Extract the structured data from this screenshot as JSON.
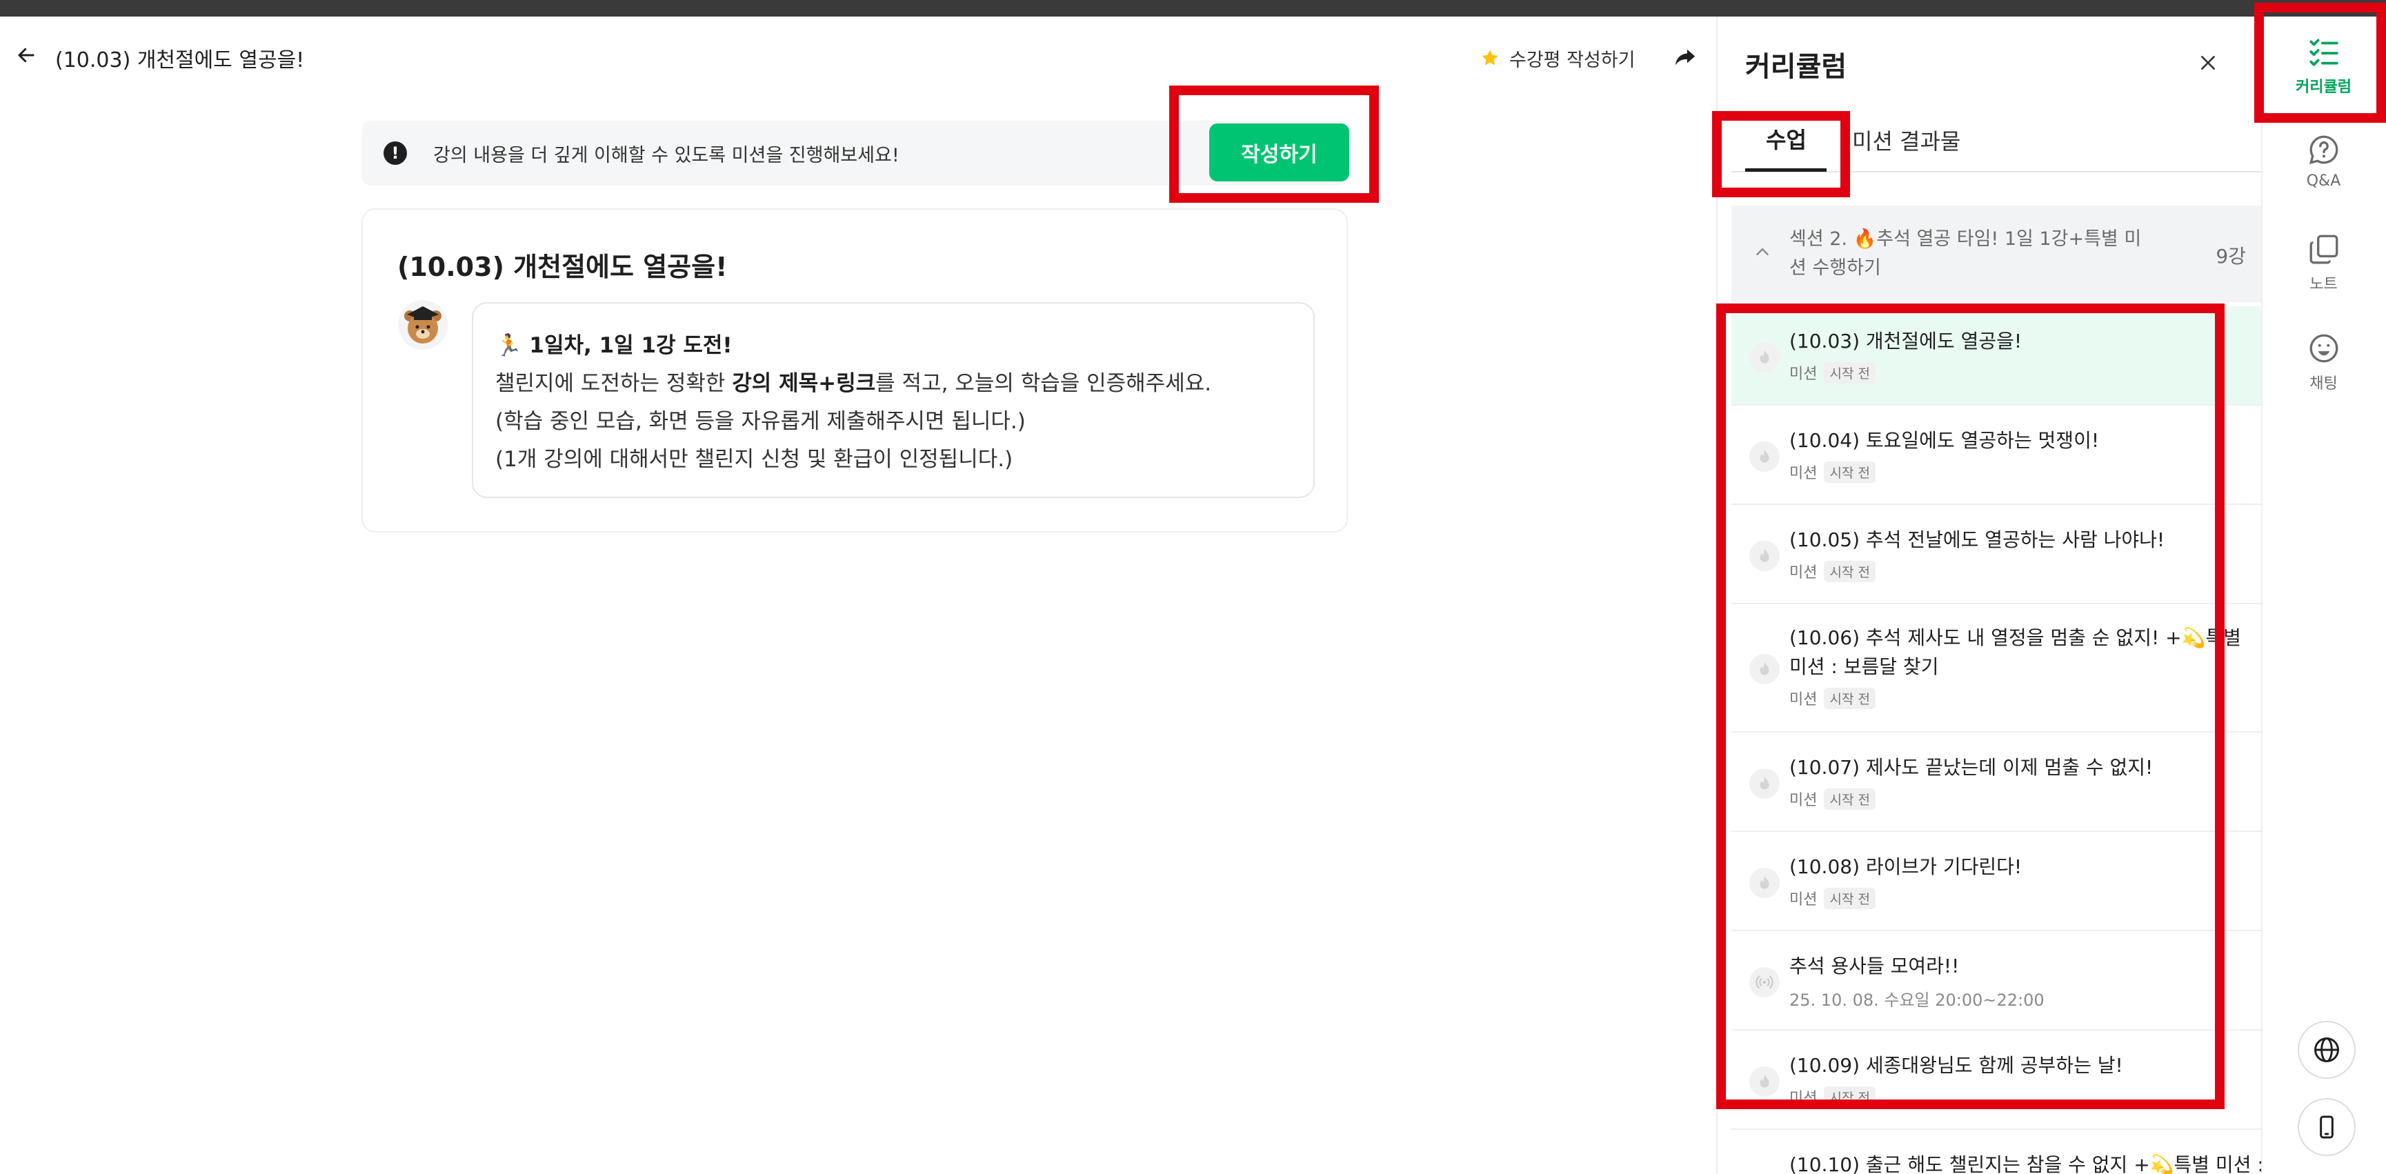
{
  "header": {
    "title": "(10.03) 개천절에도 열공을!",
    "review_label": "수강평 작성하기"
  },
  "notice": {
    "text": "강의 내용을 더 깊게 이해할 수 있도록 미션을 진행해보세요!",
    "write_label": "작성하기"
  },
  "card": {
    "title": "(10.03) 개천절에도 열공을!",
    "line1": "1일차, 1일 1강 도전!",
    "line2_pre": "챌린지에 도전하는 정확한 ",
    "line2_bold": "강의 제목+링크",
    "line2_post": "를 적고, 오늘의 학습을 인증해주세요.",
    "line3": "(학습 중인 모습, 화면 등을 자유롭게 제출해주시면 됩니다.)",
    "line4": "(1개 강의에 대해서만 챌린지 신청 및 환급이 인정됩니다.)"
  },
  "curriculum": {
    "title": "커리큘럼",
    "tab_lesson": "수업",
    "tab_mission": "미션 결과물",
    "section_title": "섹션 2. 🔥추석 열공 타임! 1일 1강+특별 미션 수행하기",
    "section_count": "9강",
    "lessons": [
      {
        "title": "(10.03) 개천절에도 열공을!",
        "type": "미션",
        "badge": "시작 전"
      },
      {
        "title": "(10.04) 토요일에도 열공하는 멋쟁이!",
        "type": "미션",
        "badge": "시작 전"
      },
      {
        "title": "(10.05) 추석 전날에도 열공하는 사람 나야나!",
        "type": "미션",
        "badge": "시작 전"
      },
      {
        "title": "(10.06) 추석 제사도 내 열정을 멈출 순 없지! +💫특별 미션 : 보름달 찾기",
        "type": "미션",
        "badge": "시작 전"
      },
      {
        "title": "(10.07) 제사도 끝났는데 이제 멈출 수 없지!",
        "type": "미션",
        "badge": "시작 전"
      },
      {
        "title": "(10.08) 라이브가 기다린다!",
        "type": "미션",
        "badge": "시작 전"
      },
      {
        "title": "추석 용사들 모여라!!",
        "time": "25. 10. 08. 수요일 20:00~22:00"
      },
      {
        "title": "(10.09) 세종대왕님도 함께 공부하는 날!",
        "type": "미션",
        "badge": "시작 전"
      },
      {
        "title": "(10.10) 출근 해도 챌린지는 참을 수 없지 +💫특별 미션 :"
      }
    ]
  },
  "nav": {
    "curriculum": "커리큘럼",
    "qa": "Q&A",
    "note": "노트",
    "chat": "채팅"
  },
  "colors": {
    "accent": "#00c471",
    "active_row": "#e9faf2",
    "highlight": "#e00010"
  }
}
